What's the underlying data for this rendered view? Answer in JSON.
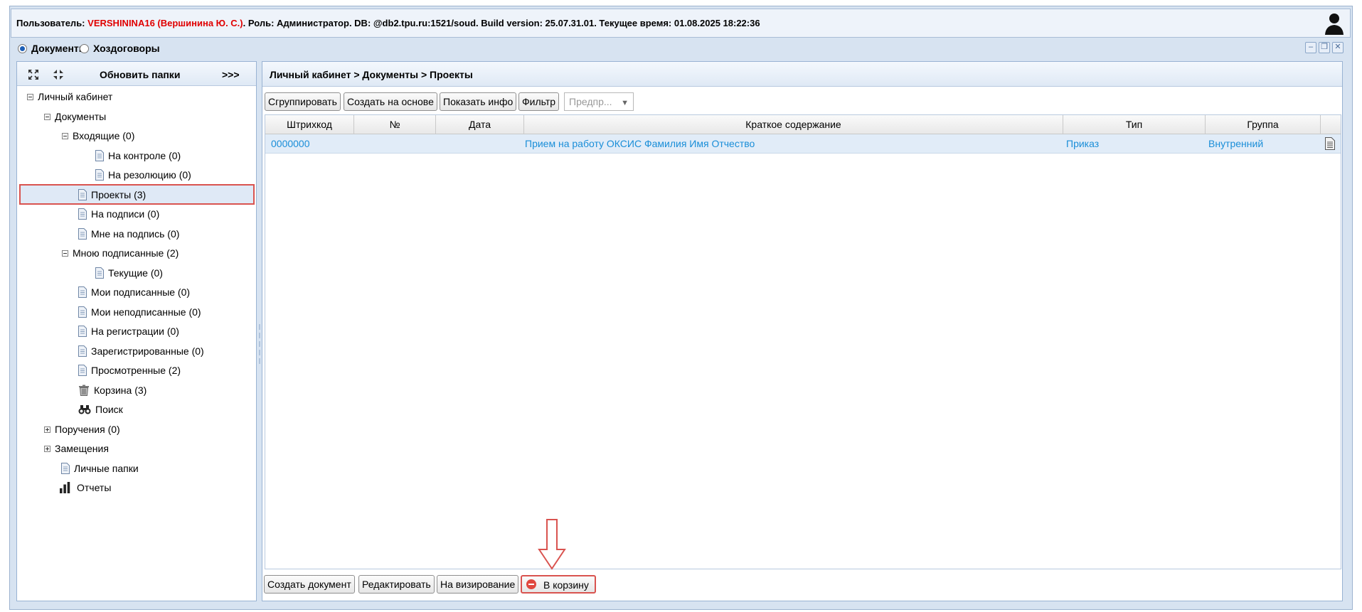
{
  "header": {
    "user_label": "Пользователь:",
    "user_name": "VERSHININA16 (Вершинина Ю. С.)",
    "rest": ". Роль: Администратор. DB: @db2.tpu.ru:1521/soud. Build version: 25.07.31.01. Текущее время: 01.08.2025 18:22:36"
  },
  "modes": {
    "documents": "Документы",
    "contracts": "Хоздоговоры",
    "selected": "Документы"
  },
  "left_panel": {
    "refresh_label": "Обновить папки",
    "more_label": ">>>",
    "tree": [
      {
        "label": "Личный кабинет",
        "icon": "minus-toggle"
      },
      {
        "label": "Документы",
        "icon": "minus-toggle"
      },
      {
        "label": "Входящие (0)",
        "icon": "minus-toggle"
      },
      {
        "label": "На контроле (0)",
        "icon": "document-icon"
      },
      {
        "label": "На резолюцию (0)",
        "icon": "document-icon"
      },
      {
        "label": "Проекты (3)",
        "icon": "document-icon",
        "selected": true
      },
      {
        "label": "На подписи (0)",
        "icon": "document-icon"
      },
      {
        "label": "Мне на подпись (0)",
        "icon": "document-icon"
      },
      {
        "label": "Мною подписанные (2)",
        "icon": "minus-toggle"
      },
      {
        "label": "Текущие (0)",
        "icon": "document-icon"
      },
      {
        "label": "Мои подписанные (0)",
        "icon": "document-icon"
      },
      {
        "label": "Мои неподписанные (0)",
        "icon": "document-icon"
      },
      {
        "label": "На регистрации (0)",
        "icon": "document-icon"
      },
      {
        "label": "Зарегистрированные (0)",
        "icon": "document-icon"
      },
      {
        "label": "Просмотренные (2)",
        "icon": "document-icon"
      },
      {
        "label": "Корзина (3)",
        "icon": "trash-icon"
      },
      {
        "label": "Поиск",
        "icon": "binoculars-icon"
      },
      {
        "label": "Поручения (0)",
        "icon": "plus-toggle"
      },
      {
        "label": "Замещения",
        "icon": "plus-toggle"
      },
      {
        "label": "Личные папки",
        "icon": "document-icon"
      },
      {
        "label": "Отчеты",
        "icon": "bar-chart-icon"
      }
    ]
  },
  "main": {
    "breadcrumb": "Личный кабинет > Документы > Проекты",
    "toolbar": {
      "group": "Сгруппировать",
      "create_based": "Создать на основе",
      "show_info": "Показать инфо",
      "filter": "Фильтр",
      "enterprise_placeholder": "Предпр..."
    },
    "columns": {
      "barcode": "Штрихкод",
      "number": "№",
      "date": "Дата",
      "summary": "Краткое содержание",
      "type": "Тип",
      "group": "Группа"
    },
    "rows": [
      {
        "barcode": "0000000",
        "number": "",
        "date": "",
        "summary": "Прием на работу ОКСИС Фамилия Имя Отчество",
        "type": "Приказ",
        "group": "Внутренний"
      }
    ],
    "bottom_buttons": {
      "create_doc": "Создать документ",
      "edit": "Редактировать",
      "to_approval": "На визирование",
      "to_trash": "В корзину"
    }
  },
  "colors": {
    "accent_red": "#d9534f",
    "link_blue": "#1a8ed8",
    "panel_border": "#99b3d3"
  }
}
